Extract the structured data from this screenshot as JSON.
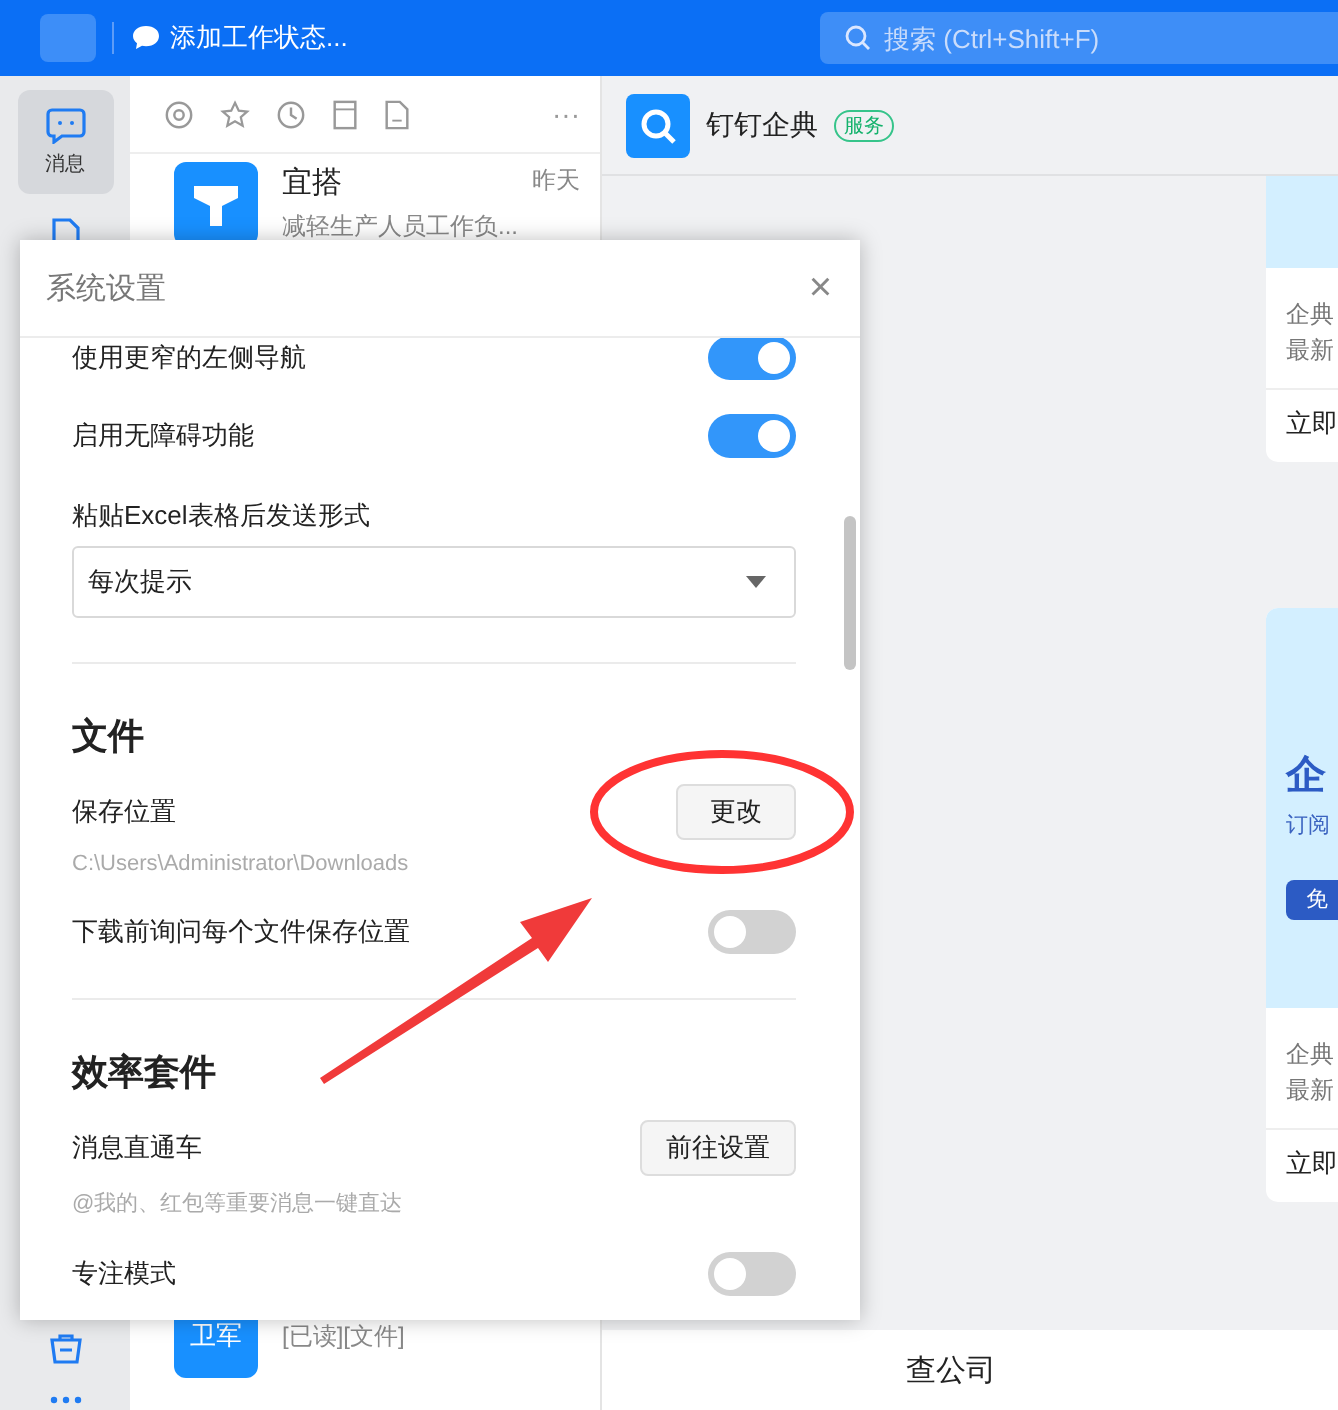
{
  "top_bar": {
    "status": "添加工作状态...",
    "search": {
      "placeholder": "搜索 (Ctrl+Shift+F)"
    }
  },
  "nav_rail": {
    "items": [
      {
        "label": "消息",
        "selected": true
      }
    ]
  },
  "chat_list": {
    "more": "···",
    "items": [
      {
        "name": "宜搭",
        "time": "昨天",
        "preview": "减轻生产人员工作负..."
      },
      {
        "avatar_text": "卫军",
        "preview": "[已读][文件]"
      }
    ]
  },
  "chat": {
    "title": "钉钉企典",
    "badge": "服务",
    "cards": [
      {
        "lines": [
          "企典",
          "最新"
        ],
        "link": "立即"
      },
      {
        "title": "企",
        "subtitle": "订阅",
        "button": "免",
        "lines": [
          "企典",
          "最新"
        ],
        "link": "立即"
      }
    ],
    "bottom_tab": "查公司"
  },
  "dialog": {
    "title": "系统设置",
    "close": "×",
    "rows": [
      {
        "kind": "toggle",
        "label": "使用更窄的左侧导航",
        "on": true
      },
      {
        "kind": "toggle",
        "label": "启用无障碍功能",
        "on": true
      },
      {
        "kind": "select",
        "label": "粘贴Excel表格后发送形式",
        "value": "每次提示"
      },
      {
        "kind": "divider"
      },
      {
        "kind": "heading",
        "text": "文件"
      },
      {
        "kind": "action",
        "label": "保存位置",
        "button": "更改",
        "note": "C:\\Users\\Administrator\\Downloads"
      },
      {
        "kind": "toggle",
        "label": "下载前询问每个文件保存位置",
        "on": false
      },
      {
        "kind": "divider"
      },
      {
        "kind": "heading",
        "text": "效率套件"
      },
      {
        "kind": "action",
        "label": "消息直通车",
        "button": "前往设置",
        "note": "@我的、红包等重要消息一键直达"
      },
      {
        "kind": "toggle",
        "label": "专注模式",
        "on": false
      }
    ]
  }
}
